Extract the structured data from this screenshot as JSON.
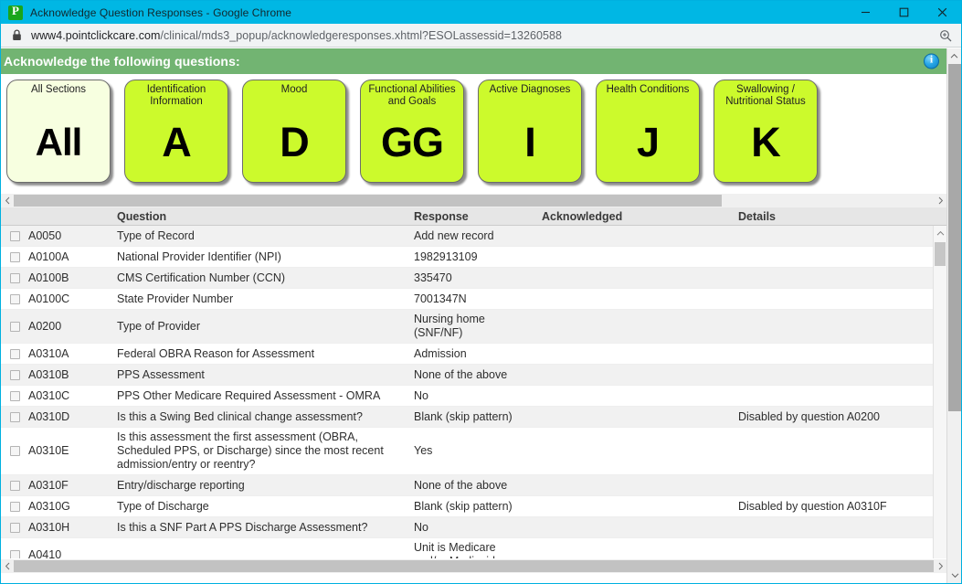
{
  "window": {
    "title": "Acknowledge Question Responses - Google Chrome",
    "favicon": "pointclickcare-icon",
    "minimize_label": "–",
    "maximize_label": "□",
    "close_label": "✕"
  },
  "omnibox": {
    "lock_icon": "lock-icon",
    "domain": "www4.pointclickcare.com",
    "path": "/clinical/mds3_popup/acknowledgeresponses.xhtml?ESOLassessid=13260588",
    "zoom_icon": "zoom-magnifier-icon"
  },
  "banner": {
    "title": "Acknowledge the following questions:",
    "info_icon": "info-icon",
    "background": "#72b472"
  },
  "sections": {
    "active_background": "#ccfa2c",
    "selected_background": "#f7ffe0",
    "items": [
      {
        "name": "All Sections",
        "code": "All",
        "selected": true
      },
      {
        "name": "Identification\nInformation",
        "code": "A",
        "selected": false
      },
      {
        "name": "Mood",
        "code": "D",
        "selected": false
      },
      {
        "name": "Functional Abilities\nand Goals",
        "code": "GG",
        "selected": false
      },
      {
        "name": "Active Diagnoses",
        "code": "I",
        "selected": false
      },
      {
        "name": "Health Conditions",
        "code": "J",
        "selected": false
      },
      {
        "name": "Swallowing /\nNutritional Status",
        "code": "K",
        "selected": false
      }
    ]
  },
  "table": {
    "headers": {
      "checkbox": "",
      "code": "",
      "question": "Question",
      "response": "Response",
      "acknowledged": "Acknowledged",
      "details": "Details"
    },
    "rows": [
      {
        "code": "A0050",
        "question": "Type of Record",
        "response": "Add new record",
        "acknowledged": "",
        "details": ""
      },
      {
        "code": "A0100A",
        "question": "National Provider Identifier (NPI)",
        "response": "1982913109",
        "acknowledged": "",
        "details": ""
      },
      {
        "code": "A0100B",
        "question": "CMS Certification Number (CCN)",
        "response": "335470",
        "acknowledged": "",
        "details": ""
      },
      {
        "code": "A0100C",
        "question": "State Provider Number",
        "response": "7001347N",
        "acknowledged": "",
        "details": ""
      },
      {
        "code": "A0200",
        "question": "Type of Provider",
        "response": "Nursing home\n(SNF/NF)",
        "acknowledged": "",
        "details": ""
      },
      {
        "code": "A0310A",
        "question": "Federal OBRA Reason for Assessment",
        "response": "Admission",
        "acknowledged": "",
        "details": ""
      },
      {
        "code": "A0310B",
        "question": "PPS Assessment",
        "response": "None of the above",
        "acknowledged": "",
        "details": ""
      },
      {
        "code": "A0310C",
        "question": "PPS Other Medicare Required Assessment - OMRA",
        "response": "No",
        "acknowledged": "",
        "details": ""
      },
      {
        "code": "A0310D",
        "question": "Is this a Swing Bed clinical change assessment?",
        "response": "Blank (skip pattern)",
        "acknowledged": "",
        "details": "Disabled by question A0200"
      },
      {
        "code": "A0310E",
        "question": "Is this assessment the first assessment (OBRA,\nScheduled PPS, or Discharge) since the most recent\nadmission/entry or reentry?",
        "response": "Yes",
        "acknowledged": "",
        "details": ""
      },
      {
        "code": "A0310F",
        "question": "Entry/discharge reporting",
        "response": "None of the above",
        "acknowledged": "",
        "details": ""
      },
      {
        "code": "A0310G",
        "question": "Type of Discharge",
        "response": "Blank (skip pattern)",
        "acknowledged": "",
        "details": "Disabled by question A0310F"
      },
      {
        "code": "A0310H",
        "question": "Is this a SNF Part A PPS Discharge Assessment?",
        "response": "No",
        "acknowledged": "",
        "details": ""
      },
      {
        "code": "A0410",
        "question": "",
        "response": "Unit is Medicare\nand/or Medicaid",
        "acknowledged": "",
        "details": ""
      }
    ]
  },
  "scrollbars": {
    "top_h_thumb_pct": 77,
    "bottom_h_thumb_pct": 100,
    "table_v_thumb": "small",
    "page_v_thumb": "large"
  }
}
